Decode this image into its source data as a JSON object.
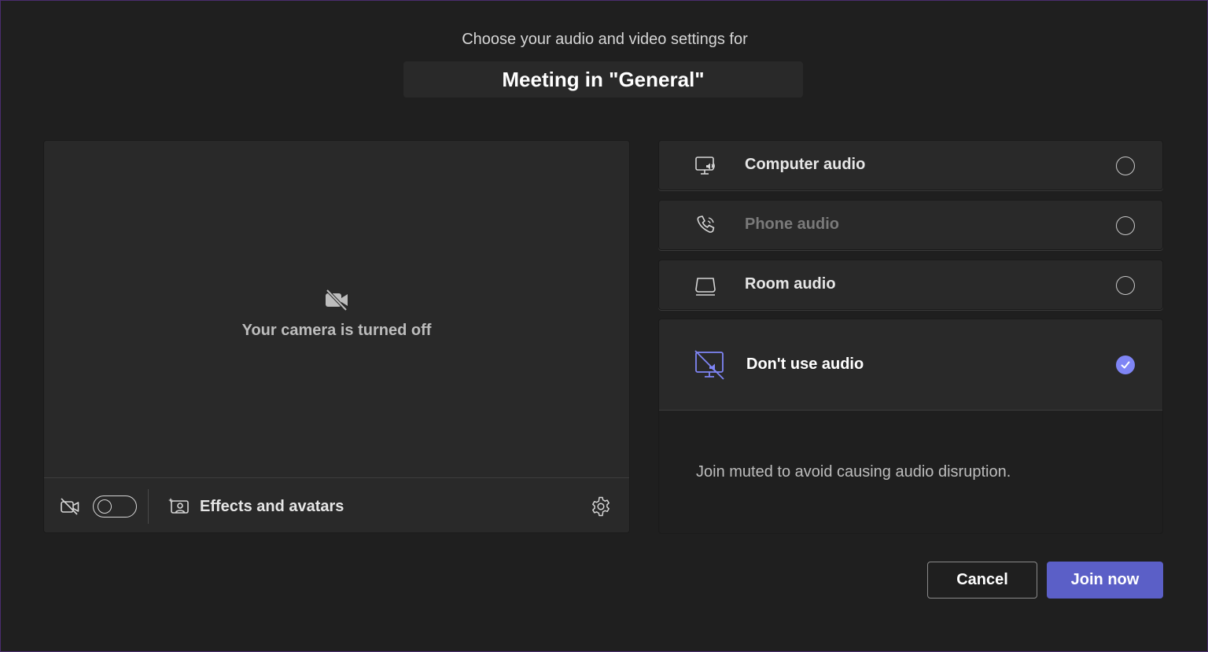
{
  "header": {
    "subtitle": "Choose your audio and video settings for",
    "meeting_title": "Meeting in \"General\""
  },
  "video": {
    "status_text": "Your camera is turned off",
    "camera_toggle_on": false,
    "effects_label": "Effects and avatars"
  },
  "audio_options": [
    {
      "label": "Computer audio",
      "icon": "computer-audio-icon",
      "selected": false,
      "disabled": false
    },
    {
      "label": "Phone audio",
      "icon": "phone-audio-icon",
      "selected": false,
      "disabled": true
    },
    {
      "label": "Room audio",
      "icon": "room-audio-icon",
      "selected": false,
      "disabled": false
    },
    {
      "label": "Don't use audio",
      "icon": "no-audio-icon",
      "selected": true,
      "disabled": false
    }
  ],
  "no_audio": {
    "description": "Join muted to avoid causing audio disruption."
  },
  "actions": {
    "cancel_label": "Cancel",
    "join_label": "Join now"
  },
  "colors": {
    "accent": "#5b5fc7",
    "accent_light": "#7f85f5",
    "background": "#1f1f1f",
    "surface": "#292929"
  }
}
